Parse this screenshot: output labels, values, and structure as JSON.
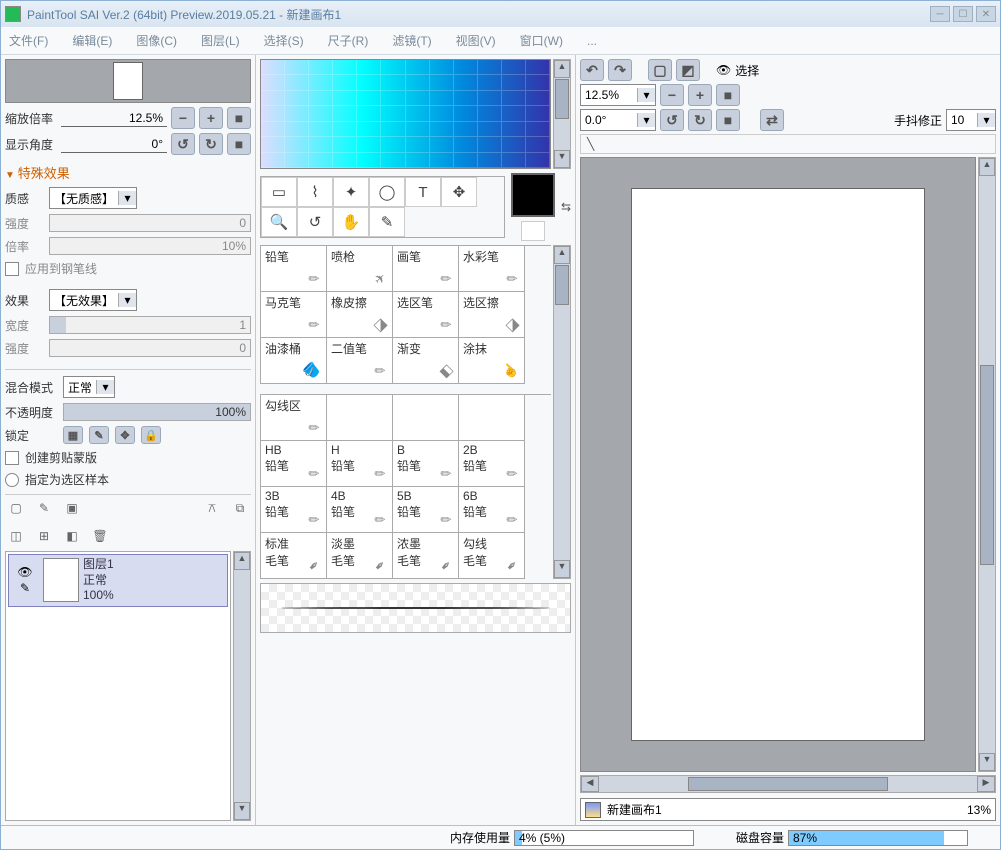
{
  "title": "PaintTool SAI Ver.2 (64bit) Preview.2019.05.21 - 新建画布1",
  "menu": [
    "文件(F)",
    "编辑(E)",
    "图像(C)",
    "图层(L)",
    "选择(S)",
    "尺子(R)",
    "滤镜(T)",
    "视图(V)",
    "窗口(W)",
    "..."
  ],
  "nav": {
    "zoom_label": "缩放倍率",
    "zoom_value": "12.5%",
    "angle_label": "显示角度",
    "angle_value": "0°"
  },
  "fx": {
    "header": "特殊效果",
    "texture_label": "质感",
    "texture_value": "【无质感】",
    "intensity_label": "强度",
    "intensity_value": "0",
    "scale_label": "倍率",
    "scale_value": "10%",
    "apply_pen_label": "应用到钢笔线",
    "effect_label": "效果",
    "effect_value": "【无效果】",
    "width_label": "宽度",
    "width_value": "1",
    "intensity2_label": "强度",
    "intensity2_value": "0"
  },
  "layer_props": {
    "blend_label": "混合模式",
    "blend_value": "正常",
    "opacity_label": "不透明度",
    "opacity_value": "100%",
    "lock_label": "锁定",
    "clip_label": "创建剪贴蒙版",
    "selsrc_label": "指定为选区样本"
  },
  "layer": {
    "name": "图层1",
    "mode": "正常",
    "opacity": "100%"
  },
  "brushes_row1": [
    "铅笔",
    "喷枪",
    "画笔",
    "水彩笔"
  ],
  "brushes_row2": [
    "马克笔",
    "橡皮擦",
    "选区笔",
    "选区擦"
  ],
  "brushes_row3": [
    "油漆桶",
    "二值笔",
    "渐变",
    "涂抹"
  ],
  "lineset_label": "勾线区",
  "pencils_row1": [
    "HB\n铅笔",
    "H\n铅笔",
    "B\n铅笔",
    "2B\n铅笔"
  ],
  "pencils_row2": [
    "3B\n铅笔",
    "4B\n铅笔",
    "5B\n铅笔",
    "6B\n铅笔"
  ],
  "pencils_row3": [
    "标准\n毛笔",
    "淡墨\n毛笔",
    "浓墨\n毛笔",
    "勾线\n毛笔"
  ],
  "right": {
    "select_label": "选择",
    "zoom": "12.5%",
    "angle": "0.0°",
    "stab_label": "手抖修正",
    "stab_value": "10"
  },
  "canvas_tab": {
    "name": "新建画布1",
    "scale": "13%"
  },
  "status": {
    "mem_label": "内存使用量",
    "mem_value": "4% (5%)",
    "mem_fill": 4,
    "disk_label": "磁盘容量",
    "disk_value": "87%",
    "disk_fill": 87
  }
}
